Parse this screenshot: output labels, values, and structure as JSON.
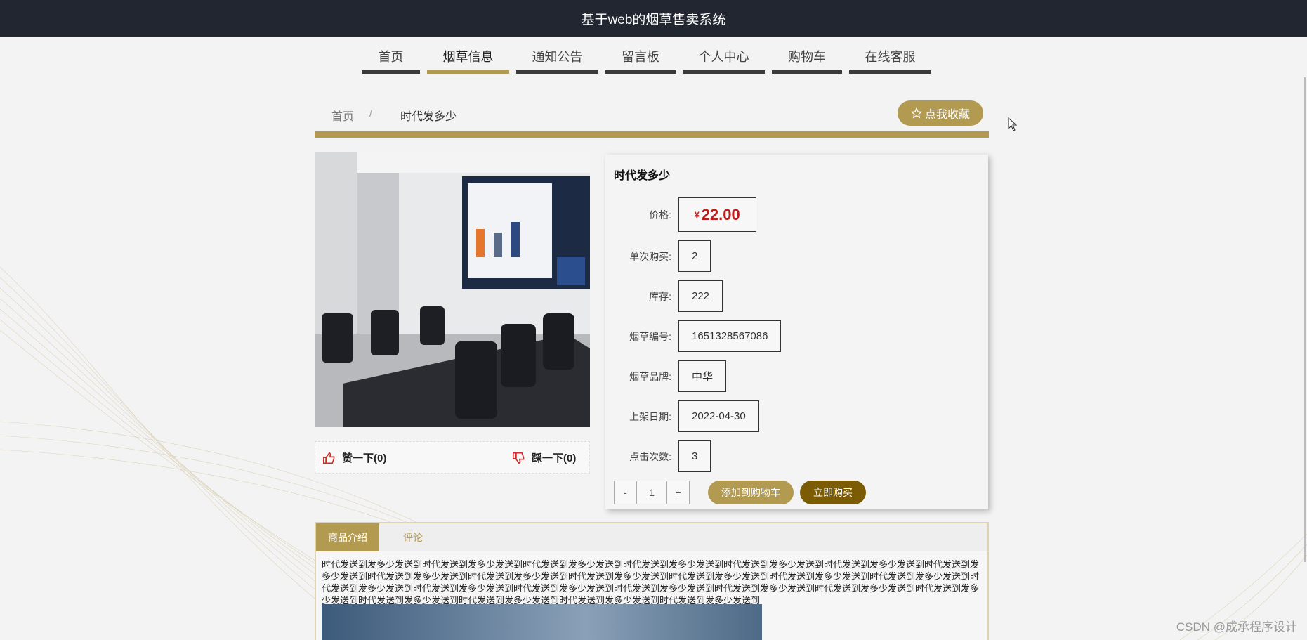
{
  "header": {
    "title": "基于web的烟草售卖系统"
  },
  "nav": {
    "items": [
      {
        "label": "首页"
      },
      {
        "label": "烟草信息"
      },
      {
        "label": "通知公告"
      },
      {
        "label": "留言板"
      },
      {
        "label": "个人中心"
      },
      {
        "label": "购物车"
      },
      {
        "label": "在线客服"
      }
    ],
    "active": "烟草信息"
  },
  "breadcrumb": {
    "home": "首页",
    "separator": "/",
    "current": "时代发多少"
  },
  "favorite_button": {
    "label": "点我收藏",
    "icon": "star-icon"
  },
  "product": {
    "title": "时代发多少",
    "price_currency": "¥",
    "price": "22.00",
    "rows": [
      {
        "label": "单次购买:",
        "value": "2"
      },
      {
        "label": "库存:",
        "value": "222"
      },
      {
        "label": "烟草编号:",
        "value": "1651328567086"
      },
      {
        "label": "烟草品牌:",
        "value": "中华"
      },
      {
        "label": "上架日期:",
        "value": "2022-04-30"
      },
      {
        "label": "点击次数:",
        "value": "3"
      }
    ],
    "price_label": "价格:"
  },
  "votes": {
    "like": "赞一下(0)",
    "dislike": "踩一下(0)"
  },
  "quantity": {
    "minus": "-",
    "value": "1",
    "plus": "+"
  },
  "actions": {
    "add_to_cart": "添加到购物车",
    "buy_now": "立即购买"
  },
  "tabs": [
    {
      "label": "商品介绍"
    },
    {
      "label": "评论"
    }
  ],
  "description": "时代发送到发多少发送到时代发送到发多少发送到时代发送到发多少发送到时代发送到发多少发送到时代发送到发多少发送到时代发送到发多少发送到时代发送到发多少发送到时代发送到发多少发送到时代发送到发多少发送到时代发送到发多少发送到时代发送到发多少发送到时代发送到发多少发送到时代发送到发多少发送到时代发送到发多少发送到时代发送到发多少发送到时代发送到发多少发送到时代发送到发多少发送到时代发送到发多少发送到时代发送到发多少发送到时代发送到发多少发送到时代发送到发多少发送到时代发送到发多少发送到时代发送到发多少发送到时代发送到发多少发送到",
  "watermark": "CSDN @成承程序设计",
  "colors": {
    "accent": "#b29a50",
    "header_bg": "#222630",
    "buy_button": "#7b5c05",
    "price": "#c01b1b"
  }
}
